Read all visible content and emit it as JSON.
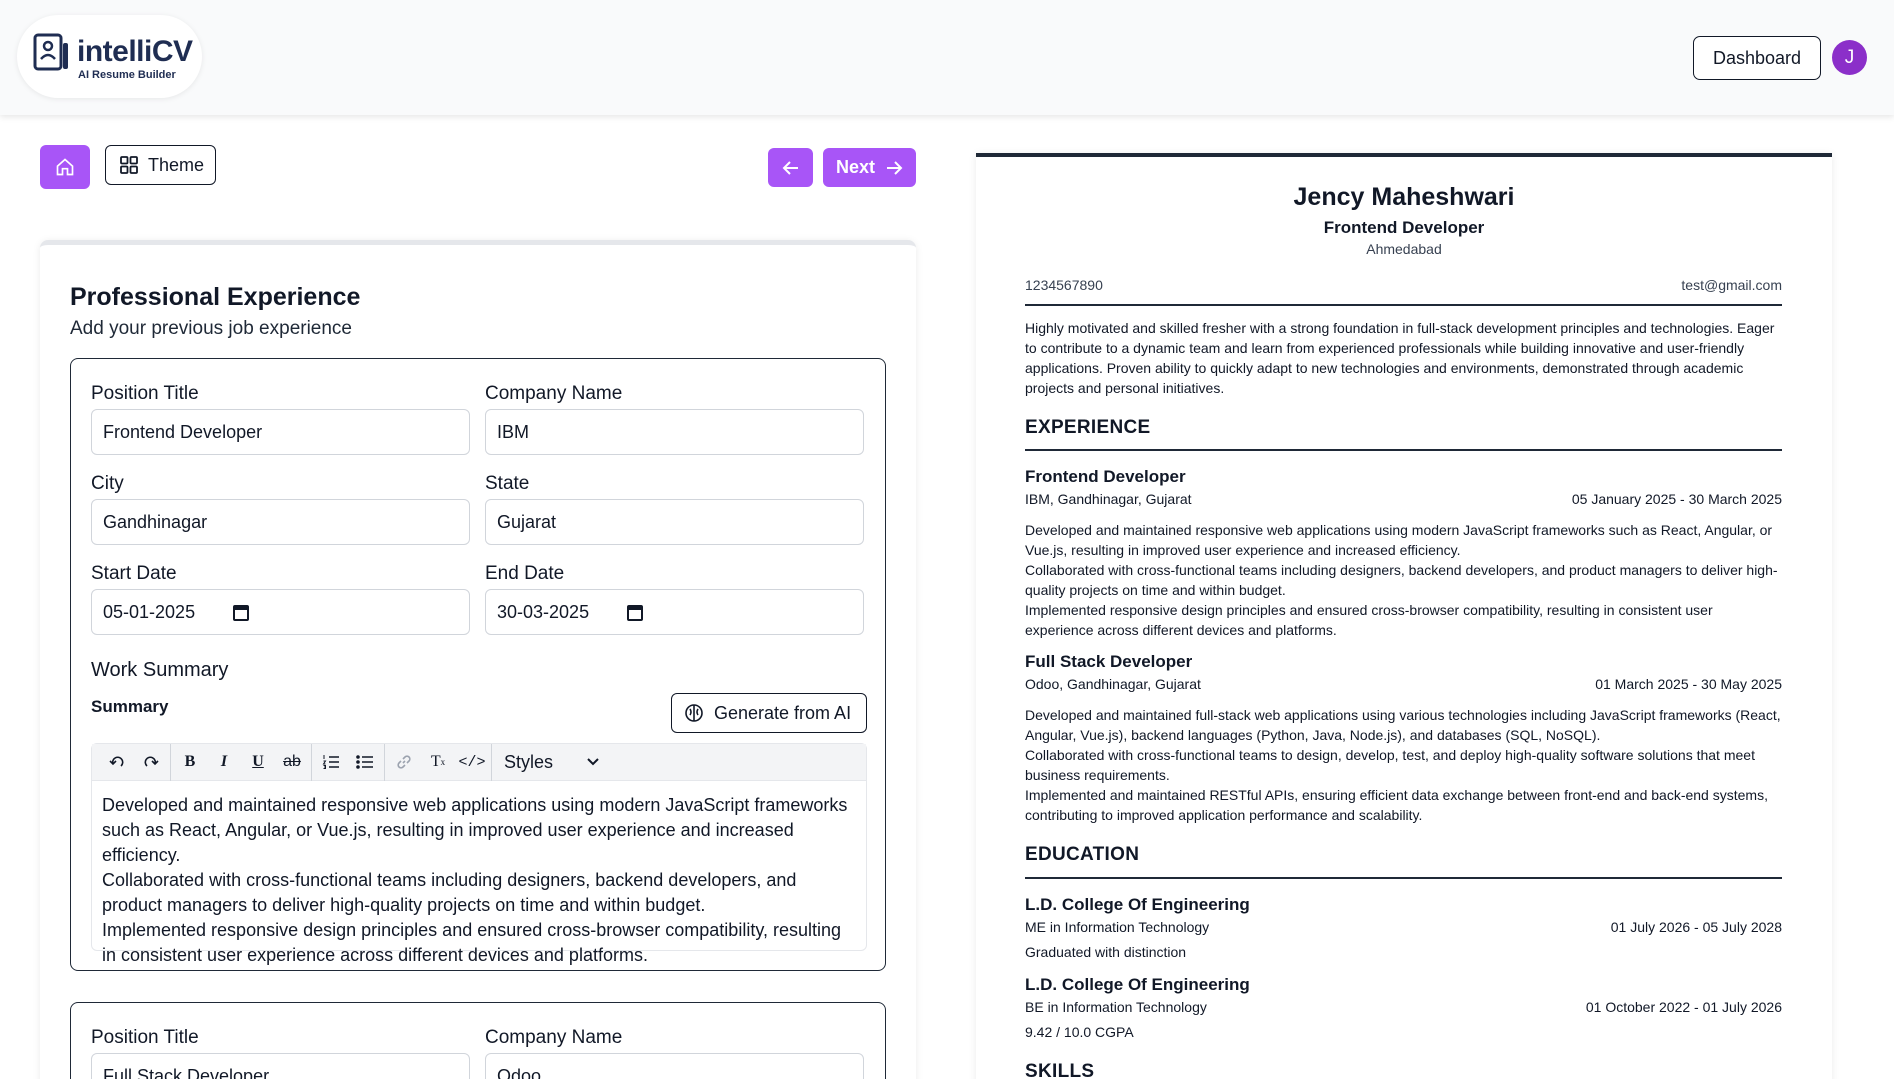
{
  "app": {
    "logo_name": "intelliCV",
    "logo_tagline": "AI Resume Builder",
    "dashboard_label": "Dashboard",
    "avatar_initial": "J"
  },
  "toolbar": {
    "theme_label": "Theme",
    "next_label": "Next"
  },
  "form": {
    "title": "Professional Experience",
    "subtitle": "Add your previous job experience",
    "labels": {
      "position": "Position Title",
      "company": "Company Name",
      "city": "City",
      "state": "State",
      "start": "Start Date",
      "end": "End Date",
      "work_summary": "Work Summary",
      "summary": "Summary",
      "generate": "Generate from AI"
    },
    "entries": [
      {
        "position": "Frontend Developer",
        "company": "IBM",
        "city": "Gandhinagar",
        "state": "Gujarat",
        "start": "05-01-2025",
        "end": "30-03-2025",
        "summary": "Developed and maintained responsive web applications using modern JavaScript frameworks such as React, Angular, or Vue.js, resulting in improved user experience and increased efficiency.\nCollaborated with cross-functional teams including designers, backend developers, and product managers to deliver high-quality projects on time and within budget.\nImplemented responsive design principles and ensured cross-browser compatibility, resulting in consistent user experience across different devices and platforms."
      },
      {
        "position": "Full Stack Developer",
        "company": "Odoo"
      }
    ],
    "editor": {
      "styles_label": "Styles",
      "tools": [
        "undo-icon",
        "redo-icon",
        "bold-icon",
        "italic-icon",
        "underline-icon",
        "strikethrough-icon",
        "numbered-list-icon",
        "bullet-list-icon",
        "link-icon",
        "clear-format-icon",
        "code-icon"
      ]
    }
  },
  "resume": {
    "name": "Jency Maheshwari",
    "role": "Frontend Developer",
    "city": "Ahmedabad",
    "phone": "1234567890",
    "email": "test@gmail.com",
    "summary": "Highly motivated and skilled fresher with a strong foundation in full-stack development principles and technologies. Eager to contribute to a dynamic team and learn from experienced professionals while building innovative and user-friendly applications. Proven ability to quickly adapt to new technologies and environments, demonstrated through academic projects and personal initiatives.",
    "experience_heading": "EXPERIENCE",
    "experience": [
      {
        "title": "Frontend Developer",
        "meta": "IBM, Gandhinagar, Gujarat",
        "dates": "05 January 2025 - 30 March 2025",
        "desc": "Developed and maintained responsive web applications using modern JavaScript frameworks such as React, Angular, or Vue.js, resulting in improved user experience and increased efficiency.\nCollaborated with cross-functional teams including designers, backend developers, and product managers to deliver high-quality projects on time and within budget.\nImplemented responsive design principles and ensured cross-browser compatibility, resulting in consistent user experience across different devices and platforms."
      },
      {
        "title": "Full Stack Developer",
        "meta": "Odoo, Gandhinagar, Gujarat",
        "dates": "01 March 2025 - 30 May 2025",
        "desc": "Developed and maintained full-stack web applications using various technologies including JavaScript frameworks (React, Angular, Vue.js), backend languages (Python, Java, Node.js), and databases (SQL, NoSQL).\nCollaborated with cross-functional teams to design, develop, test, and deploy high-quality software solutions that meet business requirements.\nImplemented and maintained RESTful APIs, ensuring efficient data exchange between front-end and back-end systems, contributing to improved application performance and scalability."
      }
    ],
    "education_heading": "EDUCATION",
    "education": [
      {
        "school": "L.D. College Of Engineering",
        "degree": "ME in Information Technology",
        "dates": "01 July 2026 - 05 July 2028",
        "note": "Graduated with distinction"
      },
      {
        "school": "L.D. College Of Engineering",
        "degree": "BE in Information Technology",
        "dates": "01 October 2022 - 01 July 2026",
        "note": "9.42 / 10.0 CGPA"
      }
    ],
    "skills_heading": "SKILLS"
  },
  "colors": {
    "accent": "#a855f7",
    "avatar": "#8b2fc9",
    "logo": "#1f2d52"
  }
}
